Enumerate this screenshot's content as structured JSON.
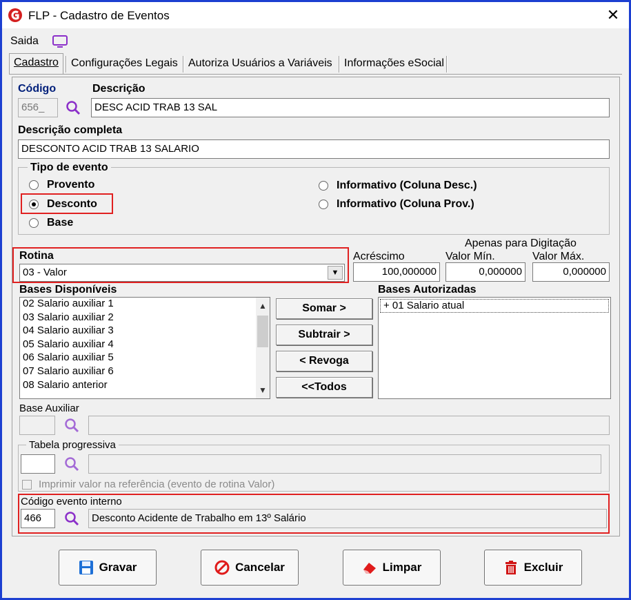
{
  "window": {
    "title": "FLP - Cadastro de Eventos",
    "close_glyph": "✕"
  },
  "menu": {
    "saida": "Saida"
  },
  "tabs": [
    {
      "label": "Cadastro",
      "active": true
    },
    {
      "label": "Configurações Legais",
      "active": false
    },
    {
      "label": "Autoriza Usuários a Variáveis",
      "active": false
    },
    {
      "label": "Informações eSocial",
      "active": false
    }
  ],
  "form": {
    "codigo_label": "Código",
    "codigo_value": "656_",
    "descricao_label": "Descrição",
    "descricao_value": "DESC ACID TRAB 13 SAL",
    "descricao_completa_label": "Descrição completa",
    "descricao_completa_value": "DESCONTO ACID TRAB 13 SALARIO",
    "tipo_evento": {
      "title": "Tipo de evento",
      "options": [
        {
          "label": "Provento",
          "checked": false
        },
        {
          "label": "Desconto",
          "checked": true
        },
        {
          "label": "Base",
          "checked": false
        },
        {
          "label": "Informativo (Coluna Desc.)",
          "checked": false
        },
        {
          "label": "Informativo (Coluna Prov.)",
          "checked": false
        }
      ]
    },
    "rotina_label": "Rotina",
    "rotina_value": "03 - Valor",
    "apenas_digitacao_label": "Apenas para Digitação",
    "acrescimo_label": "Acréscimo",
    "acrescimo_value": "100,000000",
    "valor_min_label": "Valor Mín.",
    "valor_min_value": "0,000000",
    "valor_max_label": "Valor Máx.",
    "valor_max_value": "0,000000",
    "bases_disponiveis_label": "Bases Disponíveis",
    "bases_disponiveis": [
      "02 Salario auxiliar 1",
      "03 Salario auxiliar 2",
      "04 Salario auxiliar 3",
      "05 Salario auxiliar 4",
      "06 Salario auxiliar 5",
      "07 Salario auxiliar 6",
      "08 Salario anterior"
    ],
    "bases_autorizadas_label": "Bases Autorizadas",
    "bases_autorizadas": [
      "+ 01 Salario atual"
    ],
    "buttons": {
      "somar": "Somar >",
      "subtrair": "Subtrair >",
      "revoga": "< Revoga",
      "todos": "<<Todos"
    },
    "base_auxiliar_label": "Base Auxiliar",
    "base_auxiliar_code": "",
    "base_auxiliar_desc": "",
    "tabela_progressiva_label": "Tabela progressiva",
    "tabela_progressiva_code": "",
    "tabela_progressiva_desc": "",
    "imprimir_label": "Imprimir valor na referência (evento de rotina Valor)",
    "codigo_interno_label": "Código evento interno",
    "codigo_interno_value": "466",
    "codigo_interno_desc": "Desconto Acidente de Trabalho em 13º Salário"
  },
  "footer": {
    "gravar": "Gravar",
    "cancelar": "Cancelar",
    "limpar": "Limpar",
    "excluir": "Excluir"
  },
  "colors": {
    "window_border": "#1d3fd1",
    "highlight": "#e02020",
    "search_icon": "#8b2fc9",
    "codigo_label": "#001f7a"
  }
}
